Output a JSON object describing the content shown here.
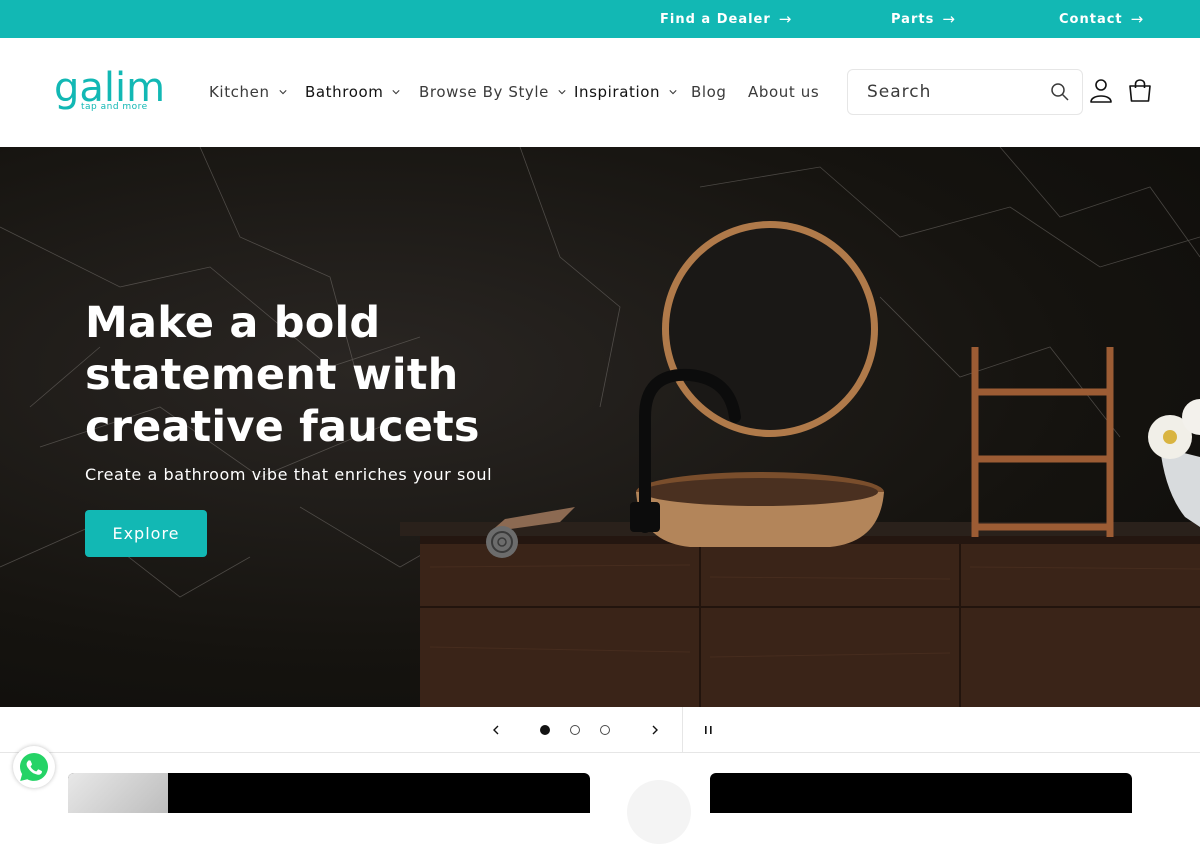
{
  "announcement": {
    "links": [
      {
        "label": "Find a Dealer"
      },
      {
        "label": "Parts"
      },
      {
        "label": "Contact"
      }
    ]
  },
  "header": {
    "logo": {
      "word": "galim",
      "tagline": "tap and more"
    },
    "nav": [
      {
        "label": "Kitchen",
        "has_dropdown": true
      },
      {
        "label": "Bathroom",
        "has_dropdown": true,
        "active": true
      },
      {
        "label": "Browse By Style",
        "has_dropdown": true
      },
      {
        "label": "Inspiration",
        "has_dropdown": true,
        "active": true
      },
      {
        "label": "Blog",
        "has_dropdown": false
      },
      {
        "label": "About us",
        "has_dropdown": false
      }
    ],
    "search": {
      "placeholder": "Search"
    }
  },
  "hero": {
    "title_lines": [
      "Make a bold",
      "statement with",
      "creative faucets"
    ],
    "subtitle": "Create a bathroom vibe that enriches your soul",
    "cta_label": "Explore"
  },
  "slider": {
    "slide_count": 3,
    "active_slide": 1
  },
  "colors": {
    "brand": "#12b8b4",
    "text": "#121212",
    "whatsapp": "#25d366"
  },
  "icons": [
    "arrow-right-icon",
    "chevron-down-icon",
    "search-icon",
    "account-icon",
    "cart-icon",
    "chevron-left-icon",
    "chevron-right-icon",
    "pause-icon",
    "whatsapp-icon"
  ]
}
